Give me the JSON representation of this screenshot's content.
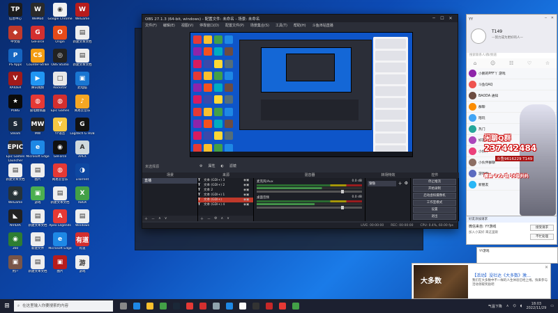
{
  "desktop_icons": [
    {
      "label": "信息中心",
      "color": "#1c1c1c",
      "glyph": "TP"
    },
    {
      "label": "WeMod",
      "color": "#2a2a2a",
      "glyph": "W"
    },
    {
      "label": "Google Chrome",
      "color": "#f1f1f1",
      "glyph": "◉"
    },
    {
      "label": "WeGame",
      "color": "#b71c1c",
      "glyph": "W"
    },
    {
      "label": "中文版",
      "color": "#c0392b",
      "glyph": "◆"
    },
    {
      "label": "GeForce",
      "color": "#d32f2f",
      "glyph": "G"
    },
    {
      "label": "Origin",
      "color": "#e64a19",
      "glyph": "O"
    },
    {
      "label": "新建文本文档",
      "color": "#eeeeee",
      "glyph": "▤"
    },
    {
      "label": "PS Apps",
      "color": "#1565c0",
      "glyph": "P"
    },
    {
      "label": "Counter-Strike",
      "color": "#f39c12",
      "glyph": "CS"
    },
    {
      "label": "OBS Studio",
      "color": "#222222",
      "glyph": "◎"
    },
    {
      "label": "新建文本文档",
      "color": "#eeeeee",
      "glyph": "▤"
    },
    {
      "label": "RAIDER",
      "color": "#a11a1a",
      "glyph": "V"
    },
    {
      "label": "腾讯视频",
      "color": "#2196f3",
      "glyph": "▶"
    },
    {
      "label": "Rockstar",
      "color": "#e8e8e8",
      "glyph": "□"
    },
    {
      "label": "此电脑",
      "color": "#1976d2",
      "glyph": "▣"
    },
    {
      "label": "PUBG",
      "color": "#0b0b0b",
      "glyph": "★"
    },
    {
      "label": "雷电模拟器",
      "color": "#e53935",
      "glyph": "◍"
    },
    {
      "label": "Epic Games",
      "color": "#d32f2f",
      "glyph": "◍"
    },
    {
      "label": "网易云音乐",
      "color": "#f5a623",
      "glyph": "♪"
    },
    {
      "label": "Steam",
      "color": "#1b2838",
      "glyph": "S"
    },
    {
      "label": "MW",
      "color": "#222222",
      "glyph": "MW"
    },
    {
      "label": "YY语音",
      "color": "#f7c843",
      "glyph": "Y"
    },
    {
      "label": "Logitech G HUB",
      "color": "#111111",
      "glyph": "G"
    },
    {
      "label": "Epic Games Launcher",
      "color": "#2b2b2b",
      "glyph": "EPIC"
    },
    {
      "label": "Microsoft Edge",
      "color": "#1e88e5",
      "glyph": "e"
    },
    {
      "label": "GeForce",
      "color": "#111111",
      "glyph": "◉"
    },
    {
      "label": "APEX",
      "color": "#cfd8dc",
      "glyph": "A"
    },
    {
      "label": "新建文本文档",
      "color": "#eeeeee",
      "glyph": "▤"
    },
    {
      "label": "图片",
      "color": "#eeeeee",
      "glyph": "▤"
    },
    {
      "label": "网易云音乐",
      "color": "#e53935",
      "glyph": "◍"
    },
    {
      "label": "uTorrent",
      "color": "#0d47a1",
      "glyph": "◑"
    },
    {
      "label": "WeGame",
      "color": "#263238",
      "glyph": "◉"
    },
    {
      "label": "游戏",
      "color": "#4caf50",
      "glyph": "▣"
    },
    {
      "label": "新建文本文档",
      "color": "#eeeeee",
      "glyph": "▤"
    },
    {
      "label": "XBOX",
      "color": "#43a047",
      "glyph": "X"
    },
    {
      "label": "NVIDIA",
      "color": "#212121",
      "glyph": "◣"
    },
    {
      "label": "新建文本文档",
      "color": "#eeeeee",
      "glyph": "▤"
    },
    {
      "label": "Apex Legends",
      "color": "#e53935",
      "glyph": "A"
    },
    {
      "label": "Windows",
      "color": "#eeeeee",
      "glyph": "▤"
    },
    {
      "label": "360",
      "color": "#2e7d32",
      "glyph": "◉"
    },
    {
      "label": "新建文件",
      "color": "#eeeeee",
      "glyph": "▤"
    },
    {
      "label": "Microsoft Edge",
      "color": "#1e88e5",
      "glyph": "e"
    },
    {
      "label": "有道",
      "color": "#d32f2f",
      "glyph": "有道"
    },
    {
      "label": "用户",
      "color": "#795548",
      "glyph": "▣"
    },
    {
      "label": "新建文本文档",
      "color": "#eeeeee",
      "glyph": "▤"
    },
    {
      "label": "图片",
      "color": "#b71c1c",
      "glyph": "▣"
    },
    {
      "label": "游戏",
      "color": "#eeeeee",
      "glyph": "游"
    }
  ],
  "obs": {
    "title": "OBS 27.1.3 (64-bit, windows) - 配置文件: 未命名 - 场景: 未命名",
    "menu": [
      "文件(F)",
      "编辑(E)",
      "视图(V)",
      "停靠窗口(D)",
      "配置文件(P)",
      "场景集合(S)",
      "工具(T)",
      "帮助(H)",
      "斗鱼/B站直播"
    ],
    "win_min": "─",
    "win_max": "☐",
    "win_close": "✕",
    "source_label": "未选择源",
    "props_label": "属性",
    "filters_label": "滤镜",
    "dock_titles": {
      "scenes": "场景",
      "sources": "来源",
      "mixer": "混音器",
      "transitions": "转场特效",
      "controls": "控件"
    },
    "scenes": [
      "直播"
    ],
    "sources": [
      "文本 (GDI+) 3",
      "文本 (GDI+) 2",
      "文本 2",
      "文本 (GDI+) 1",
      "文本 (GDI+)",
      "文本 (GDI+) 4"
    ],
    "mixer": [
      {
        "name": "麦克风/Aux",
        "db": "0.0 dB"
      },
      {
        "name": "桌面音频",
        "db": "0.0 dB"
      }
    ],
    "transition": "渐隐",
    "controls": [
      "停止推流",
      "开始录制",
      "启动虚拟摄像机",
      "工作室模式",
      "设置",
      "退出"
    ],
    "status": {
      "live": "LIVE: 00:00:00",
      "rec": "REC: 00:00:00",
      "cpu": "CPU: 0.4%, 60.00 fps"
    }
  },
  "chat": {
    "brand": "YY",
    "user": "T149",
    "signature": "—努力成为更好的人—",
    "search_placeholder": "搜索联系人/群/频道",
    "items": [
      {
        "name": "小鹏的PFF丫 游戏",
        "color": "#8e24aa"
      },
      {
        "name": "斗鱼QAQ",
        "color": "#ef5350"
      },
      {
        "name": "BAODA 通知",
        "color": "#6d4c41"
      },
      {
        "name": "群聊",
        "color": "#fb8c00"
      },
      {
        "name": "陪玩",
        "color": "#42a5f5"
      },
      {
        "name": "热门",
        "color": "#26a69a"
      },
      {
        "name": "好友",
        "color": "#ab47bc"
      },
      {
        "name": "小伙伴",
        "color": "#ec407a"
      },
      {
        "name": "小伙伴群聊",
        "color": "#8d6e63"
      },
      {
        "name": "游戏群",
        "color": "#5c6bc0"
      },
      {
        "name": "新朋友",
        "color": "#29b6f6"
      }
    ],
    "minimize": "─",
    "close": "✕"
  },
  "promo": {
    "line1": "闲聊Q群",
    "line2": "237442484",
    "qq": "斗鱼9616229 T149",
    "line3": "魔兽 #x2 或 15级妈妈"
  },
  "yy": {
    "header": "好友添加请求",
    "from": "微信来自: YY游戏",
    "desc": "加入小美好 来这里跟",
    "accept": "接受请求",
    "ignore": "不忙处理"
  },
  "qqgame": {
    "header": "YY游戏"
  },
  "game": {
    "thumb_text": "大多数",
    "title": "【活动】没社达《大多数》激…",
    "desc": "我们在大多数中不一样的人生体验已经上线，快来参与活动领取奖励吧"
  },
  "taskbar": {
    "start": "⊞",
    "search": "在这里输入你要搜索的内容",
    "weather": "气温下降",
    "time": "18:03",
    "date": "2022/11/29"
  }
}
